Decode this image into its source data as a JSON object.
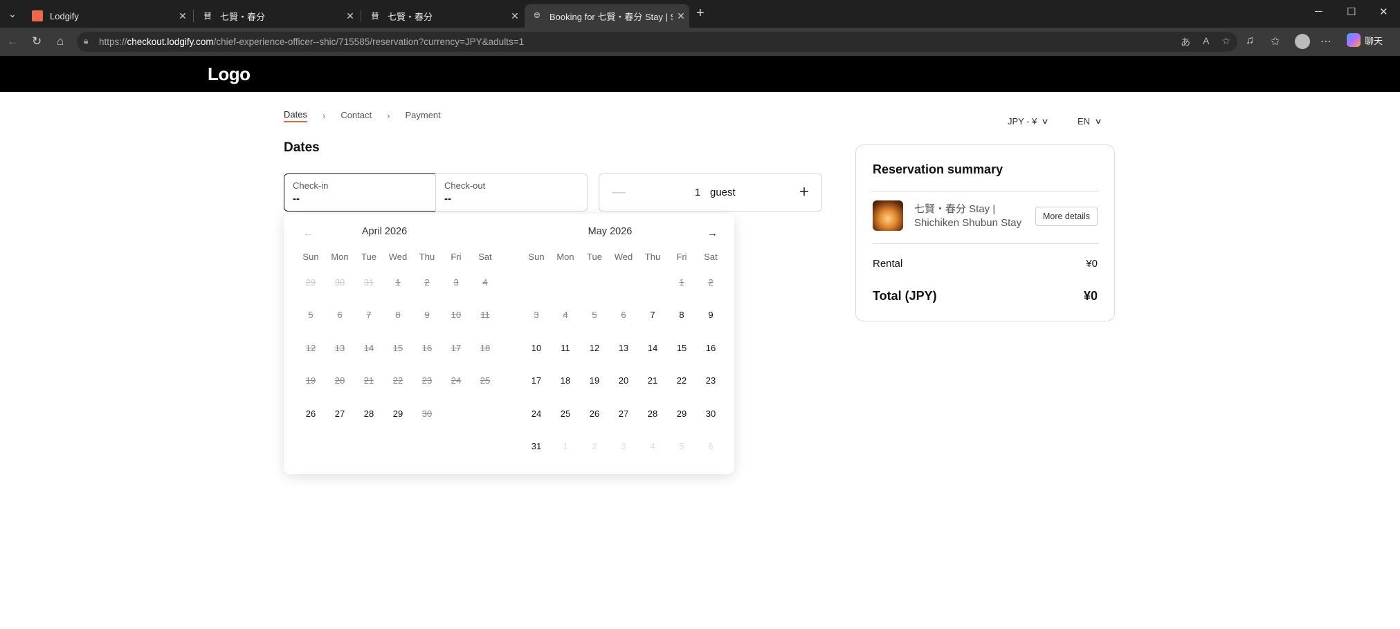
{
  "browser": {
    "tabs": [
      {
        "title": "Lodgify",
        "active": false
      },
      {
        "title": "七賢・春分",
        "active": false
      },
      {
        "title": "七賢・春分",
        "active": false
      },
      {
        "title": "Booking for 七賢・春分 Stay | Shic",
        "active": true
      }
    ],
    "url_prefix": "https://",
    "url_host": "checkout.lodgify.com",
    "url_path": "/chief-experience-officer--shic/715585/reservation?currency=JPY&adults=1",
    "copilot_label": "聊天"
  },
  "site": {
    "logo": "Logo",
    "breadcrumbs": [
      "Dates",
      "Contact",
      "Payment"
    ],
    "currency": "JPY - ¥",
    "language": "EN"
  },
  "form": {
    "section_title": "Dates",
    "checkin_label": "Check-in",
    "checkin_value": "--",
    "checkout_label": "Check-out",
    "checkout_value": "--",
    "guest_count": "1",
    "guest_label": "guest"
  },
  "calendar": {
    "weekdays": [
      "Sun",
      "Mon",
      "Tue",
      "Wed",
      "Thu",
      "Fri",
      "Sat"
    ],
    "months": [
      {
        "title": "April 2026",
        "days": [
          {
            "d": "29",
            "s": "faded"
          },
          {
            "d": "30",
            "s": "faded"
          },
          {
            "d": "31",
            "s": "faded"
          },
          {
            "d": "1",
            "s": "dis"
          },
          {
            "d": "2",
            "s": "dis"
          },
          {
            "d": "3",
            "s": "dis"
          },
          {
            "d": "4",
            "s": "dis"
          },
          {
            "d": "5",
            "s": "dis"
          },
          {
            "d": "6",
            "s": "dis"
          },
          {
            "d": "7",
            "s": "dis"
          },
          {
            "d": "8",
            "s": "dis"
          },
          {
            "d": "9",
            "s": "dis"
          },
          {
            "d": "10",
            "s": "dis"
          },
          {
            "d": "11",
            "s": "dis"
          },
          {
            "d": "12",
            "s": "dis"
          },
          {
            "d": "13",
            "s": "dis"
          },
          {
            "d": "14",
            "s": "dis"
          },
          {
            "d": "15",
            "s": "dis"
          },
          {
            "d": "16",
            "s": "dis"
          },
          {
            "d": "17",
            "s": "dis"
          },
          {
            "d": "18",
            "s": "dis"
          },
          {
            "d": "19",
            "s": "dis"
          },
          {
            "d": "20",
            "s": "dis"
          },
          {
            "d": "21",
            "s": "dis"
          },
          {
            "d": "22",
            "s": "dis"
          },
          {
            "d": "23",
            "s": "dis"
          },
          {
            "d": "24",
            "s": "dis"
          },
          {
            "d": "25",
            "s": "dis"
          },
          {
            "d": "26",
            "s": "ok"
          },
          {
            "d": "27",
            "s": "ok"
          },
          {
            "d": "28",
            "s": "ok"
          },
          {
            "d": "29",
            "s": "ok"
          },
          {
            "d": "30",
            "s": "dis"
          },
          {
            "d": "",
            "s": "empty"
          },
          {
            "d": "",
            "s": "empty"
          }
        ]
      },
      {
        "title": "May 2026",
        "days": [
          {
            "d": "",
            "s": "empty"
          },
          {
            "d": "",
            "s": "empty"
          },
          {
            "d": "",
            "s": "empty"
          },
          {
            "d": "",
            "s": "empty"
          },
          {
            "d": "",
            "s": "empty"
          },
          {
            "d": "1",
            "s": "dis"
          },
          {
            "d": "2",
            "s": "dis"
          },
          {
            "d": "3",
            "s": "dis"
          },
          {
            "d": "4",
            "s": "dis"
          },
          {
            "d": "5",
            "s": "dis"
          },
          {
            "d": "6",
            "s": "dis"
          },
          {
            "d": "7",
            "s": "ok"
          },
          {
            "d": "8",
            "s": "ok"
          },
          {
            "d": "9",
            "s": "ok"
          },
          {
            "d": "10",
            "s": "ok"
          },
          {
            "d": "11",
            "s": "ok"
          },
          {
            "d": "12",
            "s": "ok"
          },
          {
            "d": "13",
            "s": "ok"
          },
          {
            "d": "14",
            "s": "ok"
          },
          {
            "d": "15",
            "s": "ok"
          },
          {
            "d": "16",
            "s": "ok"
          },
          {
            "d": "17",
            "s": "ok"
          },
          {
            "d": "18",
            "s": "ok"
          },
          {
            "d": "19",
            "s": "ok"
          },
          {
            "d": "20",
            "s": "ok"
          },
          {
            "d": "21",
            "s": "ok"
          },
          {
            "d": "22",
            "s": "ok"
          },
          {
            "d": "23",
            "s": "ok"
          },
          {
            "d": "24",
            "s": "ok"
          },
          {
            "d": "25",
            "s": "ok"
          },
          {
            "d": "26",
            "s": "ok"
          },
          {
            "d": "27",
            "s": "ok"
          },
          {
            "d": "28",
            "s": "ok"
          },
          {
            "d": "29",
            "s": "ok"
          },
          {
            "d": "30",
            "s": "ok"
          },
          {
            "d": "31",
            "s": "ok"
          },
          {
            "d": "1",
            "s": "outm"
          },
          {
            "d": "2",
            "s": "outm"
          },
          {
            "d": "3",
            "s": "outm"
          },
          {
            "d": "4",
            "s": "outm"
          },
          {
            "d": "5",
            "s": "outm"
          },
          {
            "d": "6",
            "s": "outm"
          }
        ]
      }
    ]
  },
  "summary": {
    "title": "Reservation summary",
    "property_name": "七賢・春分 Stay | Shichiken Shubun Stay",
    "more_details": "More details",
    "rental_label": "Rental",
    "rental_value": "¥0",
    "total_label": "Total (JPY)",
    "total_value": "¥0"
  },
  "colors": {
    "accent_underline": "#d9694a",
    "header_bg": "#000000"
  }
}
